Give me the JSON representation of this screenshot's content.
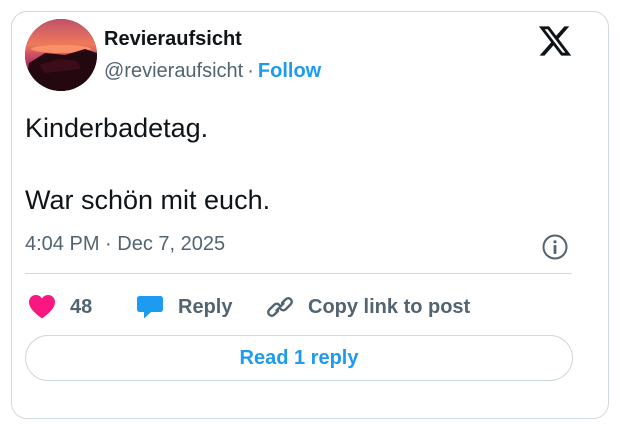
{
  "author": {
    "display_name": "Revieraufsicht",
    "handle": "@revieraufsicht",
    "separator": "·",
    "follow_label": "Follow"
  },
  "tweet": {
    "line1": "Kinderbadetag.",
    "line2": "War schön mit euch."
  },
  "meta": {
    "time": "4:04 PM",
    "separator": "·",
    "date": "Dec 7, 2025"
  },
  "actions": {
    "like_count": "48",
    "reply_label": "Reply",
    "copy_label": "Copy link to post"
  },
  "read_reply_label": "Read 1 reply",
  "icons": {
    "brand": "x-logo-icon",
    "info": "info-icon",
    "like": "heart-icon",
    "reply": "speech-bubble-icon",
    "copy": "link-icon"
  },
  "colors": {
    "accent": "#1d9bf0",
    "like": "#f91880",
    "text": "#0f1419",
    "muted": "#536471",
    "border": "#cfd9de"
  }
}
